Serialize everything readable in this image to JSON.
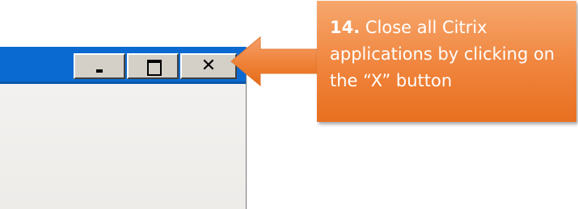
{
  "window": {
    "titlebar_color": "#0b6ad1",
    "buttons": {
      "minimize": {
        "icon": "minimize-icon",
        "glyph": "_"
      },
      "maximize": {
        "icon": "maximize-icon",
        "glyph": "□"
      },
      "close": {
        "icon": "close-icon",
        "glyph": "✕"
      }
    }
  },
  "callout": {
    "step_number": "14.",
    "text": " Close all Citrix applications by clicking on the “X” button",
    "color": "#f0843c"
  }
}
